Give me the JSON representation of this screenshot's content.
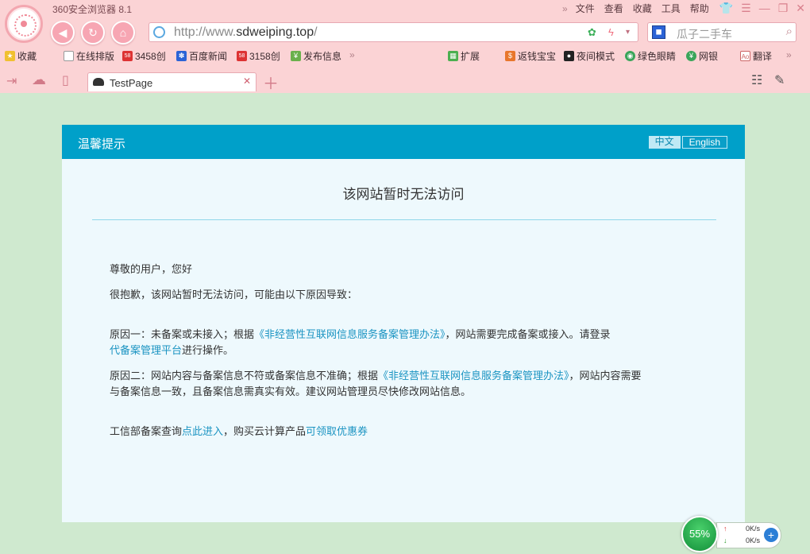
{
  "browser": {
    "title": "360安全浏览器 8.1",
    "menu": [
      "文件",
      "查看",
      "收藏",
      "工具",
      "帮助"
    ],
    "url_prefix": "http://www.",
    "url_domain": "sdweiping.top",
    "url_suffix": "/",
    "search_placeholder": "瓜子二手车",
    "favorites": [
      "收藏",
      "在线排版",
      "3458创",
      "百度新闻",
      "3158创",
      "发布信息"
    ],
    "extensions": [
      "扩展",
      "返钱宝宝",
      "夜间模式",
      "绿色眼睛",
      "网银",
      "翻译"
    ],
    "tab_label": "TestPage",
    "more_chevron": "»"
  },
  "page": {
    "header_title": "温馨提示",
    "lang_zh": "中文",
    "lang_en": "English",
    "main_title": "该网站暂时无法访问",
    "greeting": "尊敬的用户，您好",
    "intro": "很抱歉，该网站暂时无法访问，可能由以下原因导致：",
    "reason1_a": "原因一：未备案或未接入；根据",
    "reason1_link": "《非经营性互联网信息服务备案管理办法》",
    "reason1_b": "，网站需要完成备案或接入。请登录",
    "reason1_link2": "代备案管理平台",
    "reason1_c": "进行操作。",
    "reason2_a": "原因二：网站内容与备案信息不符或备案信息不准确；根据",
    "reason2_link": "《非经营性互联网信息服务备案管理办法》",
    "reason2_b": "，网站内容需要",
    "reason2_c": "与备案信息一致，且备案信息需真实有效。建议网站管理员尽快修改网站信息。",
    "footer_a": "工信部备案查询",
    "footer_link1": "点此进入",
    "footer_b": "，购买云计算产品",
    "footer_link2": "可领取优惠券"
  },
  "speed_widget": {
    "percent": "55%",
    "up": "0K/s",
    "down": "0K/s"
  },
  "colors": {
    "chrome": "#fbd3d5",
    "page_bg": "#cfe9cf",
    "header": "#00a0c9",
    "link": "#1b94c2"
  }
}
